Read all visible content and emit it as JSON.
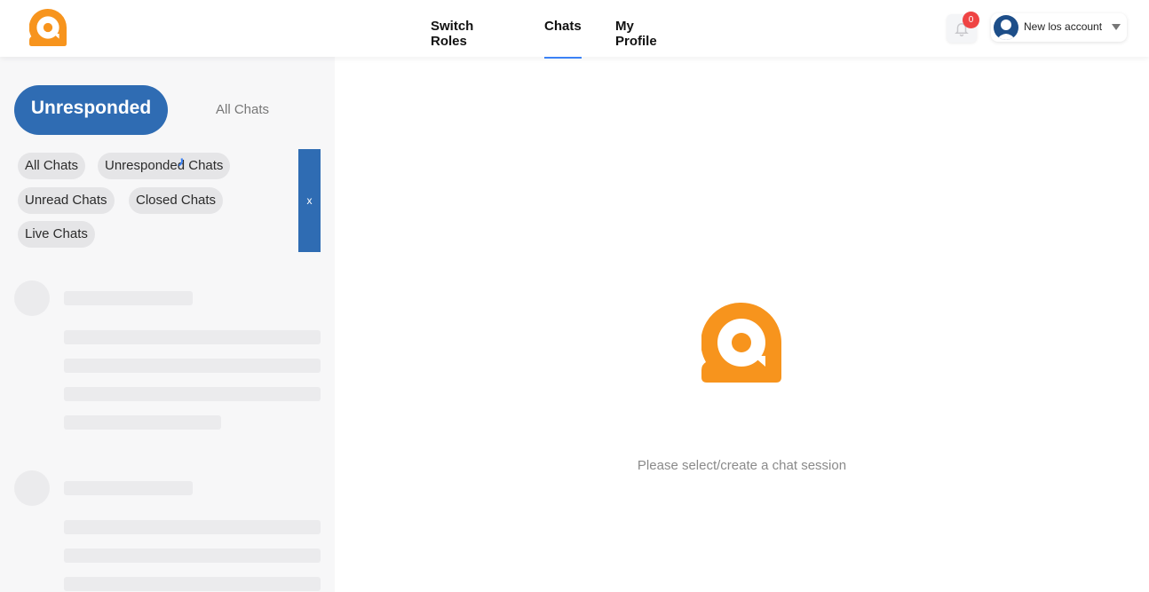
{
  "header": {
    "nav": [
      {
        "label": "Switch Roles",
        "active": false
      },
      {
        "label": "Chats",
        "active": true
      },
      {
        "label": "My Profile",
        "active": false
      }
    ],
    "notification_count": "0",
    "account_name": "New los account",
    "icons": {
      "logo": "chat-bubble-a-logo",
      "bell": "bell-icon",
      "avatar": "user-avatar-icon",
      "caret": "chevron-down-icon"
    }
  },
  "sidebar": {
    "primary_tabs": {
      "active": "Unresponded",
      "other": "All Chats"
    },
    "filters": [
      "All Chats",
      "Unresponded Chats",
      "Unread Chats",
      "Closed Chats",
      "Live Chats"
    ],
    "close_label": "x"
  },
  "main": {
    "empty_message": "Please select/create a chat session"
  },
  "colors": {
    "brand_orange": "#f7941d",
    "primary_blue": "#2f6cb3",
    "active_underline": "#3b82f6",
    "badge_red": "#ef4444"
  }
}
